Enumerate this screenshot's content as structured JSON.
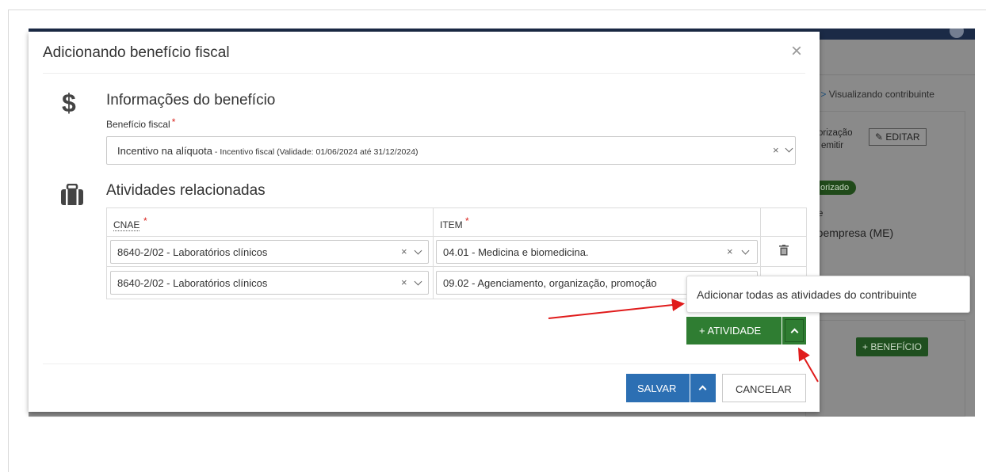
{
  "background": {
    "breadcrumb_ellipsis": "s >",
    "breadcrumb_current": "Visualizando contribuinte",
    "auth_line1": "orização",
    "auth_line2": "emitir",
    "edit_label": "EDITAR",
    "status_badge": "orizado",
    "tipo_label": "e",
    "tipo_value": "roempresa (ME)",
    "beneficio_button": "+ BENEFÍCIO"
  },
  "modal": {
    "title": "Adicionando benefício fiscal",
    "close_symbol": "×",
    "info_section": {
      "heading": "Informações do benefício",
      "field_label": "Benefício fiscal",
      "required_mark": "*",
      "selected_value_main": "Incentivo na alíquota",
      "selected_value_detail": " - Incentivo fiscal (Validade: 01/06/2024 até 31/12/2024)"
    },
    "activities_section": {
      "heading": "Atividades relacionadas",
      "columns": {
        "cnae": "CNAE",
        "item": "ITEM",
        "required_mark": "*"
      },
      "rows": [
        {
          "cnae": "8640-2/02 - Laboratórios clínicos",
          "item": "04.01 - Medicina e biomedicina."
        },
        {
          "cnae": "8640-2/02 - Laboratórios clínicos",
          "item": "09.02 - Agenciamento, organização, promoção"
        }
      ]
    },
    "add_activity_button": "+ ATIVIDADE",
    "tooltip": "Adicionar todas as atividades do contribuinte",
    "save_button": "SALVAR",
    "cancel_button": "CANCELAR",
    "clear_symbol": "×"
  },
  "colors": {
    "primary_blue": "#2c6fb3",
    "success_green": "#2f7d32",
    "required_red": "#d9231d",
    "annotation_red": "#e01b1b"
  },
  "icons": [
    "dollar-icon",
    "briefcase-icon",
    "trash-icon",
    "chevron-down-icon",
    "chevron-up-icon",
    "close-icon",
    "pencil-icon"
  ]
}
